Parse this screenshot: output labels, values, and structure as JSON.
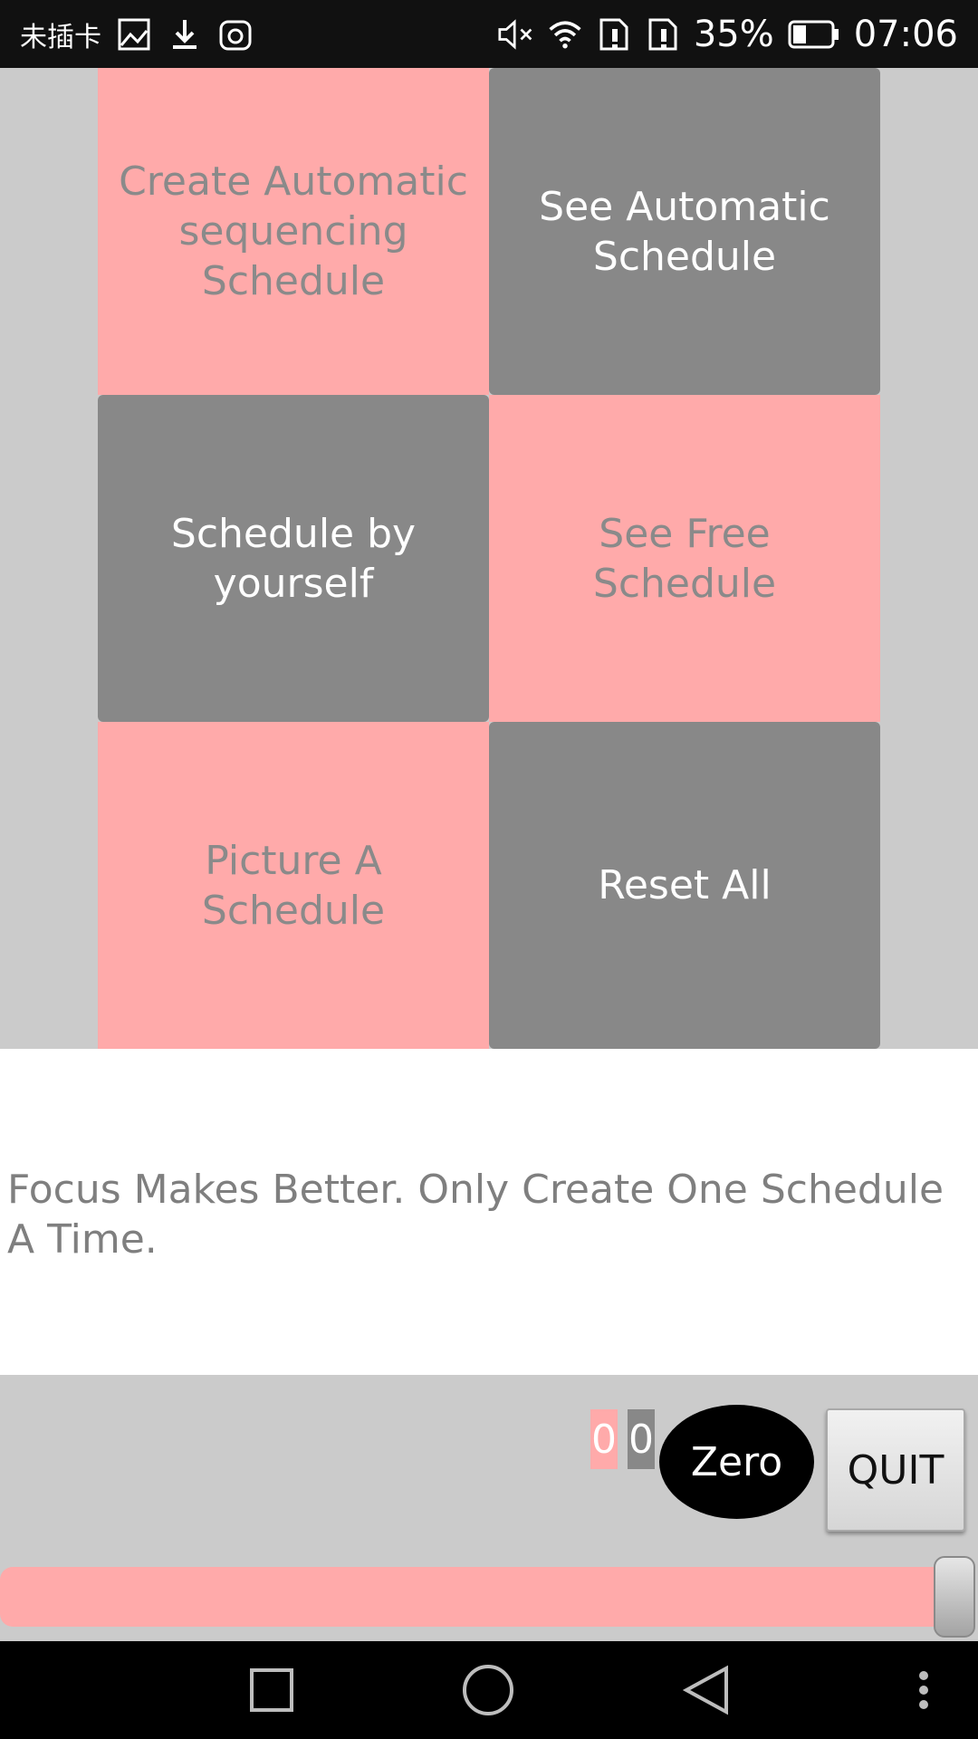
{
  "status_bar": {
    "carrier": "未插卡",
    "battery_percent": "35%",
    "time": "07:06",
    "icons": [
      "image-icon",
      "download-icon",
      "app-icon",
      "mute-icon",
      "wifi-icon",
      "sim1-icon",
      "sim2-icon",
      "battery-icon"
    ]
  },
  "tiles": [
    {
      "label": "Create Automatic sequencing Schedule"
    },
    {
      "label": "See Automatic Schedule"
    },
    {
      "label": "Schedule by yourself"
    },
    {
      "label": "See Free Schedule"
    },
    {
      "label": "Picture A Schedule"
    },
    {
      "label": "Reset All"
    }
  ],
  "message": "Focus Makes Better. Only Create One Schedule A Time.",
  "bottom": {
    "counter_pink": "0",
    "counter_gray": "0",
    "zero_label": "Zero",
    "quit_label": "QUIT",
    "progress_fraction": 1.0
  },
  "nav_bar": {
    "buttons": [
      "recent-apps-icon",
      "home-icon",
      "back-icon",
      "overflow-menu-icon"
    ]
  },
  "colors": {
    "pink": "#ffaaaa",
    "gray_tile": "#888888",
    "panel_bg": "#cbcbcb"
  }
}
